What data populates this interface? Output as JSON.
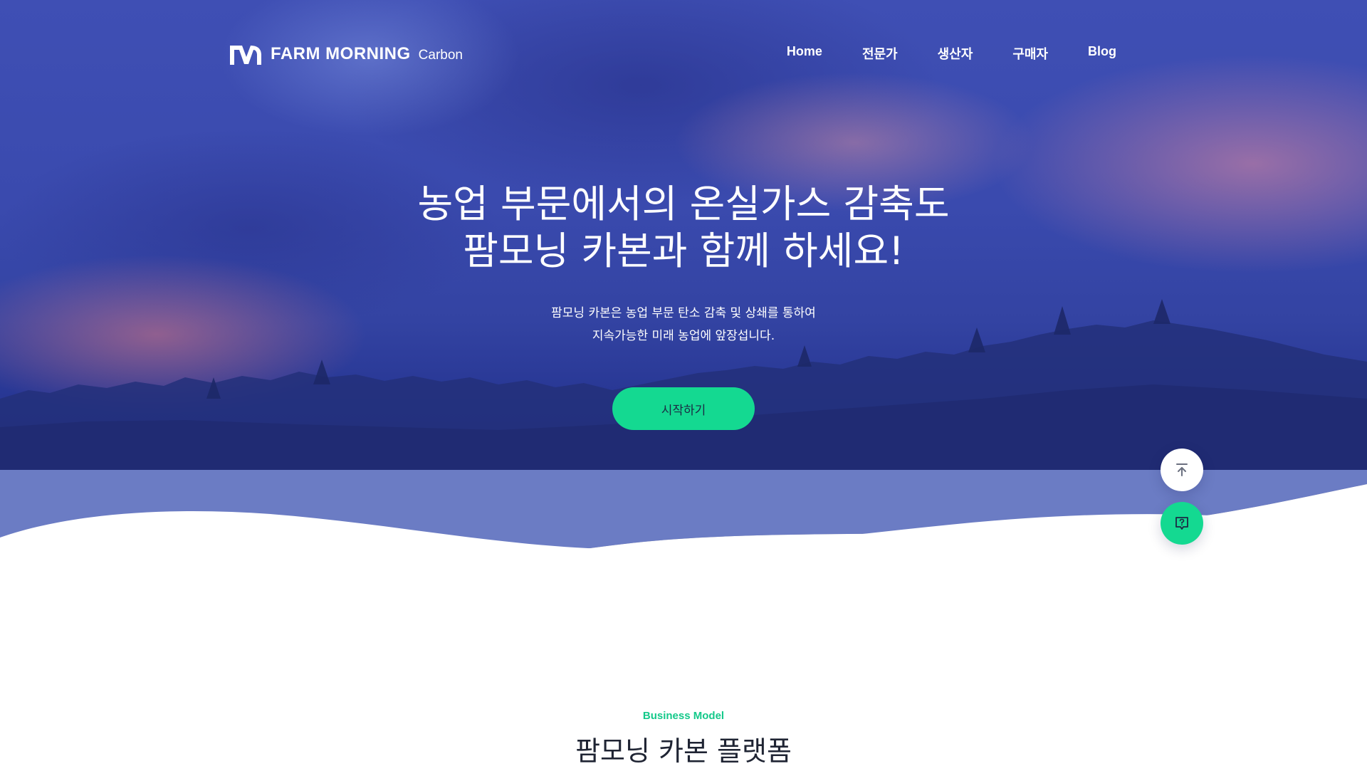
{
  "brand": {
    "name": "FARM MORNING",
    "product": "Carbon"
  },
  "nav": {
    "items": [
      {
        "label": "Home"
      },
      {
        "label": "전문가"
      },
      {
        "label": "생산자"
      },
      {
        "label": "구매자"
      },
      {
        "label": "Blog"
      }
    ]
  },
  "hero": {
    "headline_line1": "농업 부문에서의 온실가스 감축도",
    "headline_line2": "팜모닝 카본과 함께 하세요!",
    "sub_line1": "팜모닝 카본은 농업 부문 탄소 감축 및 상쇄를 통하여",
    "sub_line2": "지속가능한 미래 농업에 앞장섭니다.",
    "cta_label": "시작하기"
  },
  "floating": {
    "top_icon": "arrow-up-to-top-icon",
    "help_icon": "question-chat-icon"
  },
  "section": {
    "eyebrow": "Business Model",
    "title": "팜모닝 카본 플랫폼"
  },
  "colors": {
    "accent": "#14d991",
    "hero_overlay": "#3343a2",
    "wave": "#6b7cc4",
    "text_dark": "#1f2433"
  }
}
